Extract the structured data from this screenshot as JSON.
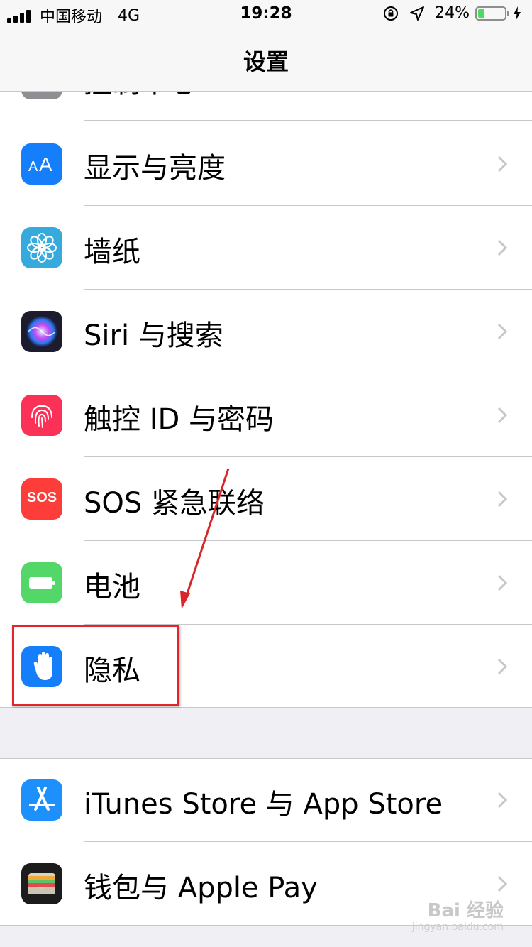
{
  "status_bar": {
    "carrier": "中国移动",
    "network": "4G",
    "time": "19:28",
    "battery": "24%",
    "battery_level": 0.24
  },
  "nav": {
    "title": "设置"
  },
  "rows": [
    {
      "id": "control-center",
      "label": "控制中心",
      "icon": "control-center-icon",
      "color": "#8e8e93"
    },
    {
      "id": "display",
      "label": "显示与亮度",
      "icon": "display-brightness-icon",
      "color": "#147efb"
    },
    {
      "id": "wallpaper",
      "label": "墙纸",
      "icon": "wallpaper-flower-icon",
      "color": "#36aadc"
    },
    {
      "id": "siri",
      "label": "Siri 与搜索",
      "icon": "siri-icon",
      "color": "#1c1c2e"
    },
    {
      "id": "touch-id",
      "label": "触控 ID 与密码",
      "icon": "fingerprint-icon",
      "color": "#fc3158"
    },
    {
      "id": "sos",
      "label": "SOS 紧急联络",
      "icon": "sos-icon",
      "icon_text": "SOS",
      "color": "#fc3d39"
    },
    {
      "id": "battery",
      "label": "电池",
      "icon": "battery-icon",
      "color": "#53d769"
    },
    {
      "id": "privacy",
      "label": "隐私",
      "icon": "hand-icon",
      "color": "#147efb"
    },
    {
      "id": "itunes",
      "label": "iTunes Store 与 App Store",
      "icon": "app-store-icon",
      "color": "#1e90fb"
    },
    {
      "id": "wallet",
      "label": "钱包与 Apple Pay",
      "icon": "wallet-icon",
      "color": "#1c1c1c"
    }
  ],
  "watermark": {
    "text": "Bai 经验",
    "sub": "jingyan.baidu.com"
  }
}
